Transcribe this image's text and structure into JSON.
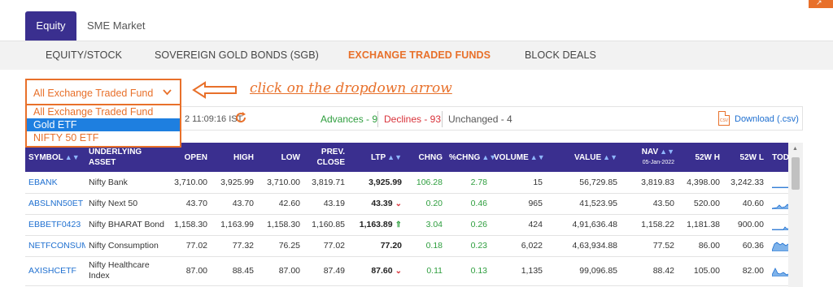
{
  "top_tabs": [
    "Equity",
    "SME Market"
  ],
  "sub_nav": [
    "EQUITY/STOCK",
    "SOVEREIGN GOLD BONDS (SGB)",
    "EXCHANGE TRADED FUNDS",
    "BLOCK DEALS"
  ],
  "dropdown": {
    "selected": "All Exchange Traded Fund",
    "options": [
      "All Exchange Traded Fund",
      "Gold ETF",
      "NIFTY 50 ETF"
    ],
    "highlighted_index": 1
  },
  "annotation": "click on the dropdown arrow",
  "info": {
    "timestamp": "2 11:09:16 IST",
    "advances": "Advances - 9",
    "declines": "Declines - 93",
    "unchanged": "Unchanged - 4",
    "download": "Download (.csv)",
    "csv_icon_text": "CSV"
  },
  "table": {
    "headers": {
      "symbol": "SYMBOL",
      "underlying": "UNDERLYING ASSET",
      "open": "OPEN",
      "high": "HIGH",
      "low": "LOW",
      "prev_close": "PREV. CLOSE",
      "ltp": "LTP",
      "chng": "CHNG",
      "pchng": "%CHNG",
      "volume": "VOLUME",
      "value": "VALUE",
      "nav": "NAV",
      "nav_date": "05-Jan-2022",
      "w52h": "52W H",
      "w52l": "52W L",
      "today": "TODAY"
    },
    "rows": [
      {
        "symbol": "EBANK",
        "asset": "Nifty Bank",
        "open": "3,710.00",
        "high": "3,925.99",
        "low": "3,710.00",
        "prev": "3,819.71",
        "ltp": "3,925.99",
        "trend": "none",
        "chng": "106.28",
        "pchng": "2.78",
        "volume": "15",
        "value": "56,729.85",
        "nav": "3,819.83",
        "w52h": "4,398.00",
        "w52l": "3,242.33"
      },
      {
        "symbol": "ABSLNN50ET",
        "asset": "Nifty Next 50",
        "open": "43.70",
        "high": "43.70",
        "low": "42.60",
        "prev": "43.19",
        "ltp": "43.39",
        "trend": "down",
        "chng": "0.20",
        "pchng": "0.46",
        "volume": "965",
        "value": "41,523.95",
        "nav": "43.50",
        "w52h": "520.00",
        "w52l": "40.60"
      },
      {
        "symbol": "EBBETF0423",
        "asset": "Nifty BHARAT Bond",
        "open": "1,158.30",
        "high": "1,163.99",
        "low": "1,158.30",
        "prev": "1,160.85",
        "ltp": "1,163.89",
        "trend": "up",
        "chng": "3.04",
        "pchng": "0.26",
        "volume": "424",
        "value": "4,91,636.48",
        "nav": "1,158.22",
        "w52h": "1,181.38",
        "w52l": "900.00"
      },
      {
        "symbol": "NETFCONSUM",
        "asset": "Nifty Consumption",
        "open": "77.02",
        "high": "77.32",
        "low": "76.25",
        "prev": "77.02",
        "ltp": "77.20",
        "trend": "none",
        "chng": "0.18",
        "pchng": "0.23",
        "volume": "6,022",
        "value": "4,63,934.88",
        "nav": "77.52",
        "w52h": "86.00",
        "w52l": "60.36"
      },
      {
        "symbol": "AXISHCETF",
        "asset": "Nifty Healthcare Index",
        "open": "87.00",
        "high": "88.45",
        "low": "87.00",
        "prev": "87.49",
        "ltp": "87.60",
        "trend": "down",
        "chng": "0.11",
        "pchng": "0.13",
        "volume": "1,135",
        "value": "99,096.85",
        "nav": "88.42",
        "w52h": "105.00",
        "w52l": "82.00"
      }
    ]
  },
  "colors": {
    "accent": "#e8702a",
    "header_bg": "#3a2f8f",
    "link": "#1e6fd0",
    "positive": "#2e9e3e",
    "negative": "#d9323a",
    "highlight": "#1e7fe0"
  }
}
